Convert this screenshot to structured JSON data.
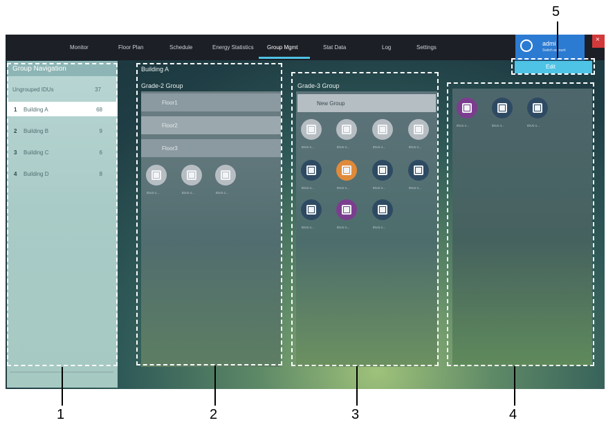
{
  "menu": {
    "items": [
      "Monitor",
      "Floor Plan",
      "Schedule",
      "Energy Statistics",
      "Group Mgmt",
      "Stat Data",
      "Log",
      "Settings"
    ],
    "active": "Group Mgmt"
  },
  "user": {
    "name": "admi",
    "switch": "Switch account",
    "close": "×"
  },
  "nav": {
    "title": "Group Navigation",
    "ungrouped": {
      "label": "Ungrouped IDUs",
      "count": "37"
    },
    "items": [
      {
        "num": "1",
        "label": "Building A",
        "count": "68",
        "selected": true
      },
      {
        "num": "2",
        "label": "Building B",
        "count": "9"
      },
      {
        "num": "3",
        "label": "Building C",
        "count": "6"
      },
      {
        "num": "4",
        "label": "Building D",
        "count": "8"
      }
    ]
  },
  "col2": {
    "heading": "Building A",
    "title": "Grade-2 Group",
    "floors": [
      "Floor1",
      "Floor2",
      "Floor3"
    ],
    "unit_label": "IDU1-1..."
  },
  "col3": {
    "title": "Grade-3 Group",
    "new_group": "New Group",
    "unit_label": "IDU1-1..."
  },
  "col4": {
    "unit_label": "IDU1-1..."
  },
  "edit": {
    "label": "Edit"
  },
  "callouts": [
    "1",
    "2",
    "3",
    "4",
    "5"
  ],
  "colors": {
    "accent": "#4ec3e6",
    "user_box": "#2c7bd2",
    "close": "#d2393a",
    "orange_unit": "#e08a3a",
    "purple_unit": "#7b3e8e",
    "navy_unit": "#2e4a63"
  }
}
